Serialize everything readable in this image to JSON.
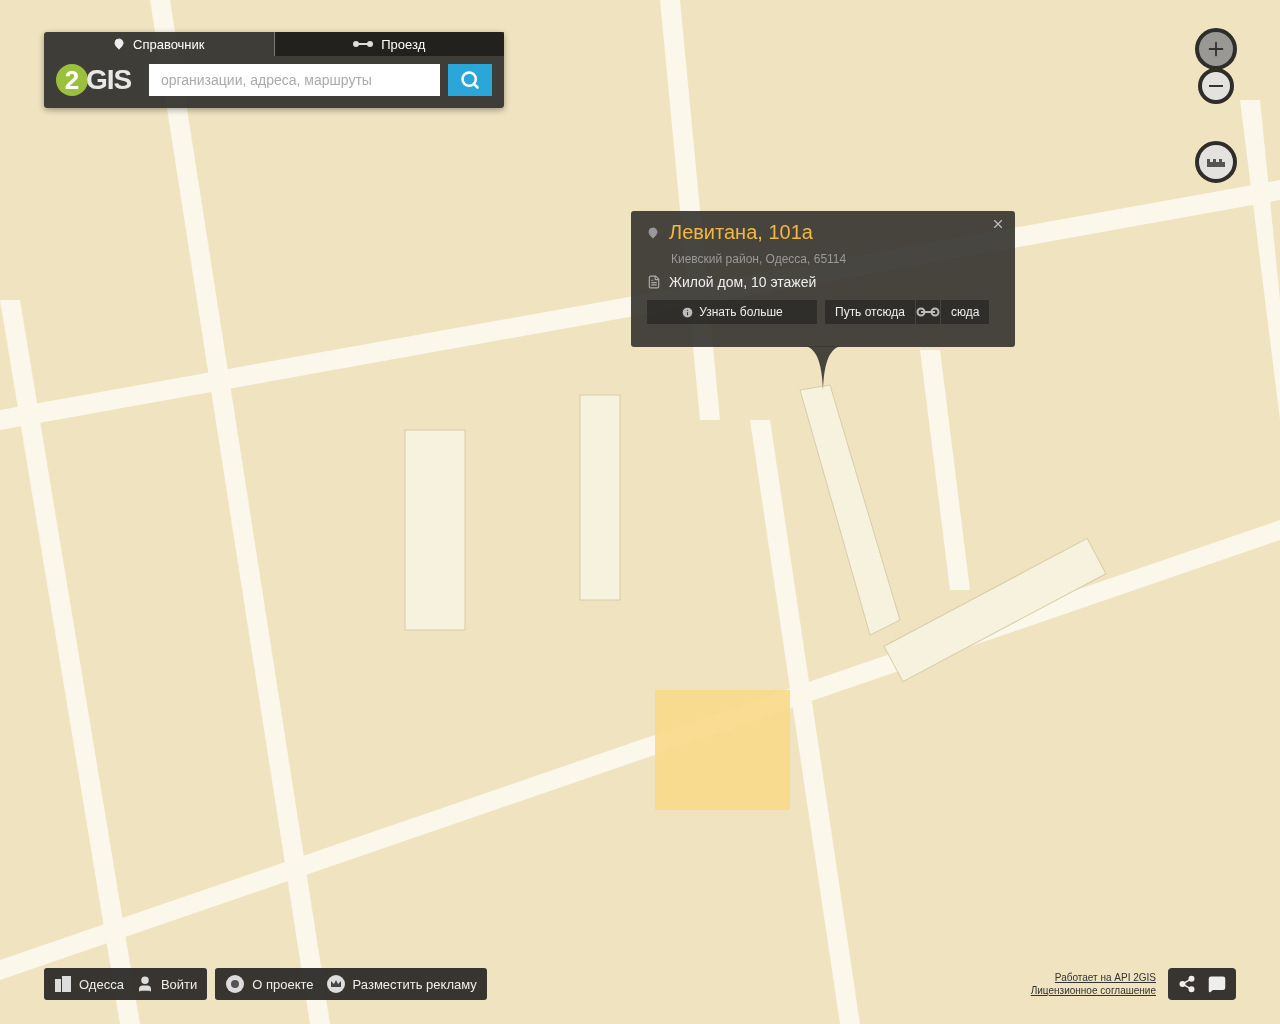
{
  "search_panel": {
    "tabs": [
      {
        "label": "Справочник",
        "selected": true
      },
      {
        "label": "Проезд",
        "selected": false
      }
    ],
    "logo": {
      "number": "2",
      "text": "GIS"
    },
    "search": {
      "placeholder": "организации, адреса, маршруты"
    }
  },
  "popup": {
    "title": "Левитана, 101а",
    "address": "Киевский район, Одесса, 65114",
    "description": "Жилой дом, 10 этажей",
    "more_button": "Узнать больше",
    "route_from": "Путь отсюда",
    "route_to": "сюда"
  },
  "bottom_bar": {
    "groups": [
      [
        {
          "label": "Одесса"
        },
        {
          "label": "Войти"
        }
      ],
      [
        {
          "label": "О проекте"
        },
        {
          "label": "Разместить рекламу"
        }
      ]
    ]
  },
  "footer_links": [
    "Работает на API 2GIS",
    "Лицензионное соглашение"
  ]
}
